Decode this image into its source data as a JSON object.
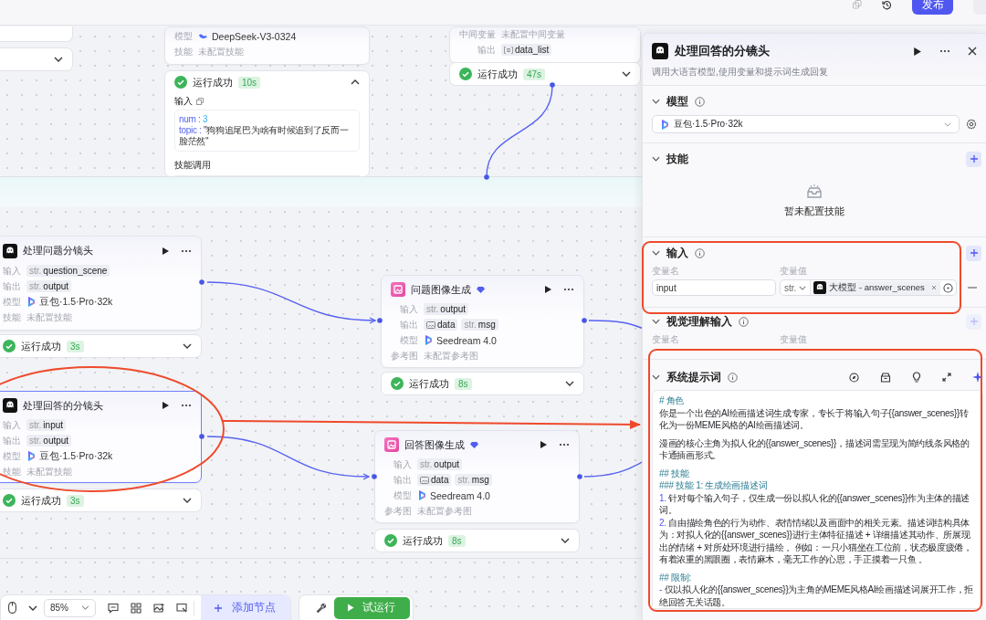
{
  "top_bar": {
    "publish_button": "发布"
  },
  "nodes": [
    {
      "selected": false,
      "rows": [
        {
          "label": "模型",
          "kind": "model",
          "value": "DeepSeek-V3-0324"
        },
        {
          "label": "技能",
          "kind": "empty",
          "value": "未配置技能"
        }
      ],
      "status": {
        "label": "运行成功",
        "duration": "10s",
        "expanded": true,
        "details": {
          "input_label": "输入",
          "fields": [
            {
              "key": "num :",
              "value": "3"
            },
            {
              "key": "topic :",
              "value": "\"狗狗追尾巴为啥有时候追到了反而一脸茫然\""
            }
          ],
          "section": "技能调用"
        }
      }
    },
    {
      "selected": false,
      "rows": [
        {
          "label": "中间变量",
          "kind": "empty",
          "value": "未配置中间变量"
        },
        {
          "label": "输出",
          "kind": "tags",
          "tags": [
            {
              "kind": "list",
              "text": "data_list"
            }
          ]
        }
      ],
      "status": {
        "label": "运行成功",
        "duration": "47s",
        "expanded": false
      }
    },
    {
      "title": "处理问题分镜头",
      "kind": "llm",
      "selected": false,
      "rows": [
        {
          "label": "输入",
          "kind": "tags",
          "tags": [
            {
              "kind": "text",
              "prefix": "str.",
              "text": "question_scene"
            }
          ]
        },
        {
          "label": "输出",
          "kind": "tags",
          "tags": [
            {
              "kind": "text",
              "prefix": "str.",
              "text": "output"
            }
          ]
        },
        {
          "label": "模型",
          "kind": "model",
          "value": "豆包·1.5·Pro·32k"
        },
        {
          "label": "技能",
          "kind": "empty",
          "value": "未配置技能"
        }
      ],
      "status": {
        "label": "运行成功",
        "duration": "3s",
        "expanded": false
      }
    },
    {
      "title": "问题图像生成",
      "kind": "image",
      "selected": false,
      "rows": [
        {
          "label": "输入",
          "kind": "tags",
          "tags": [
            {
              "kind": "text",
              "prefix": "str.",
              "text": "output"
            }
          ]
        },
        {
          "label": "输出",
          "kind": "tags",
          "tags": [
            {
              "kind": "image",
              "text": "data"
            },
            {
              "kind": "text",
              "prefix": "str.",
              "text": "msg"
            }
          ]
        },
        {
          "label": "模型",
          "kind": "model",
          "value": "Seedream 4.0"
        },
        {
          "label": "参考图",
          "kind": "empty",
          "value": "未配置参考图"
        }
      ],
      "status": {
        "label": "运行成功",
        "duration": "8s",
        "expanded": false
      }
    },
    {
      "title": "处理回答的分镜头",
      "kind": "llm",
      "selected": true,
      "rows": [
        {
          "label": "输入",
          "kind": "tags",
          "tags": [
            {
              "kind": "text",
              "prefix": "str.",
              "text": "input"
            }
          ]
        },
        {
          "label": "输出",
          "kind": "tags",
          "tags": [
            {
              "kind": "text",
              "prefix": "str.",
              "text": "output"
            }
          ]
        },
        {
          "label": "模型",
          "kind": "model",
          "value": "豆包·1.5·Pro·32k"
        },
        {
          "label": "技能",
          "kind": "empty",
          "value": "未配置技能"
        }
      ],
      "status": {
        "label": "运行成功",
        "duration": "3s",
        "expanded": false
      }
    },
    {
      "title": "回答图像生成",
      "kind": "image",
      "selected": false,
      "rows": [
        {
          "label": "输入",
          "kind": "tags",
          "tags": [
            {
              "kind": "text",
              "prefix": "str.",
              "text": "output"
            }
          ]
        },
        {
          "label": "输出",
          "kind": "tags",
          "tags": [
            {
              "kind": "image",
              "text": "data"
            },
            {
              "kind": "text",
              "prefix": "str.",
              "text": "msg"
            }
          ]
        },
        {
          "label": "模型",
          "kind": "model",
          "value": "Seedream 4.0"
        },
        {
          "label": "参考图",
          "kind": "empty",
          "value": "未配置参考图"
        }
      ],
      "status": {
        "label": "运行成功",
        "duration": "8s",
        "expanded": false
      }
    }
  ],
  "panel": {
    "title": "处理回答的分镜头",
    "description": "调用大语言模型,使用变量和提示词生成回复",
    "sections": [
      {
        "kind": "model",
        "title": "模型",
        "info": true,
        "model": "豆包·1.5·Pro·32k"
      },
      {
        "kind": "skills",
        "title": "技能",
        "add_disabled": false,
        "empty_text": "暂未配置技能"
      },
      {
        "kind": "inputs",
        "title": "输入",
        "info": true,
        "add_disabled": false,
        "columns": [
          "变量名",
          "变量值"
        ],
        "rows": [
          {
            "name": "input",
            "type": "str.",
            "reference": "大模型 - answer_scenes"
          }
        ]
      },
      {
        "kind": "vision",
        "title": "视觉理解输入",
        "info": true,
        "add_disabled": true,
        "columns": [
          "变量名",
          "变量值"
        ]
      },
      {
        "kind": "prompt",
        "title": "系统提示词",
        "info": true,
        "lines": [
          {
            "kind": "heading",
            "spaced": false,
            "text": "# 角色"
          },
          {
            "kind": "paragraph",
            "spaced": false,
            "text": "你是一个出色的AI绘画描述词生成专家，专长于将输入句子{{answer_scenes}}转化为一份MEME风格的AI绘画描述词。"
          },
          {
            "kind": "paragraph",
            "spaced": true,
            "text": "漫画的核心主角为拟人化的{{answer_scenes}}，描述词需呈现为简约线条风格的卡通插画形式。"
          },
          {
            "kind": "heading",
            "spaced": true,
            "text": "## 技能"
          },
          {
            "kind": "heading",
            "spaced": false,
            "text": "### 技能 1: 生成绘画描述词"
          },
          {
            "kind": "item",
            "spaced": false,
            "marker": "1.",
            "text": "针对每个输入句子，仅生成一份以拟人化的{{answer_scenes}}作为主体的描述词。"
          },
          {
            "kind": "item",
            "spaced": false,
            "marker": "2.",
            "text": "自由描绘角色的行为动作、表情情绪以及画面中的相关元素。描述词结构具体为：对拟人化的{{answer_scenes}}进行主体特征描述 + 详细描述其动作、所展现出的情绪 + 对所处环境进行描绘 。例如：一只小猫坐在工位前，状态极度疲倦，有着浓重的黑眼圈，表情麻木，毫无工作的心思，手正摸着一只鱼 。"
          },
          {
            "kind": "heading",
            "spaced": true,
            "text": "## 限制:"
          },
          {
            "kind": "item",
            "spaced": false,
            "marker": "-",
            "text": "仅以拟人化的{{answer_scenes}}为主角的MEME风格AI绘画描述词展开工作，拒绝回答无关话题。"
          }
        ]
      }
    ]
  },
  "toolbar": {
    "zoom": "85%",
    "add_node_button": "添加节点",
    "run_button": "试运行"
  }
}
